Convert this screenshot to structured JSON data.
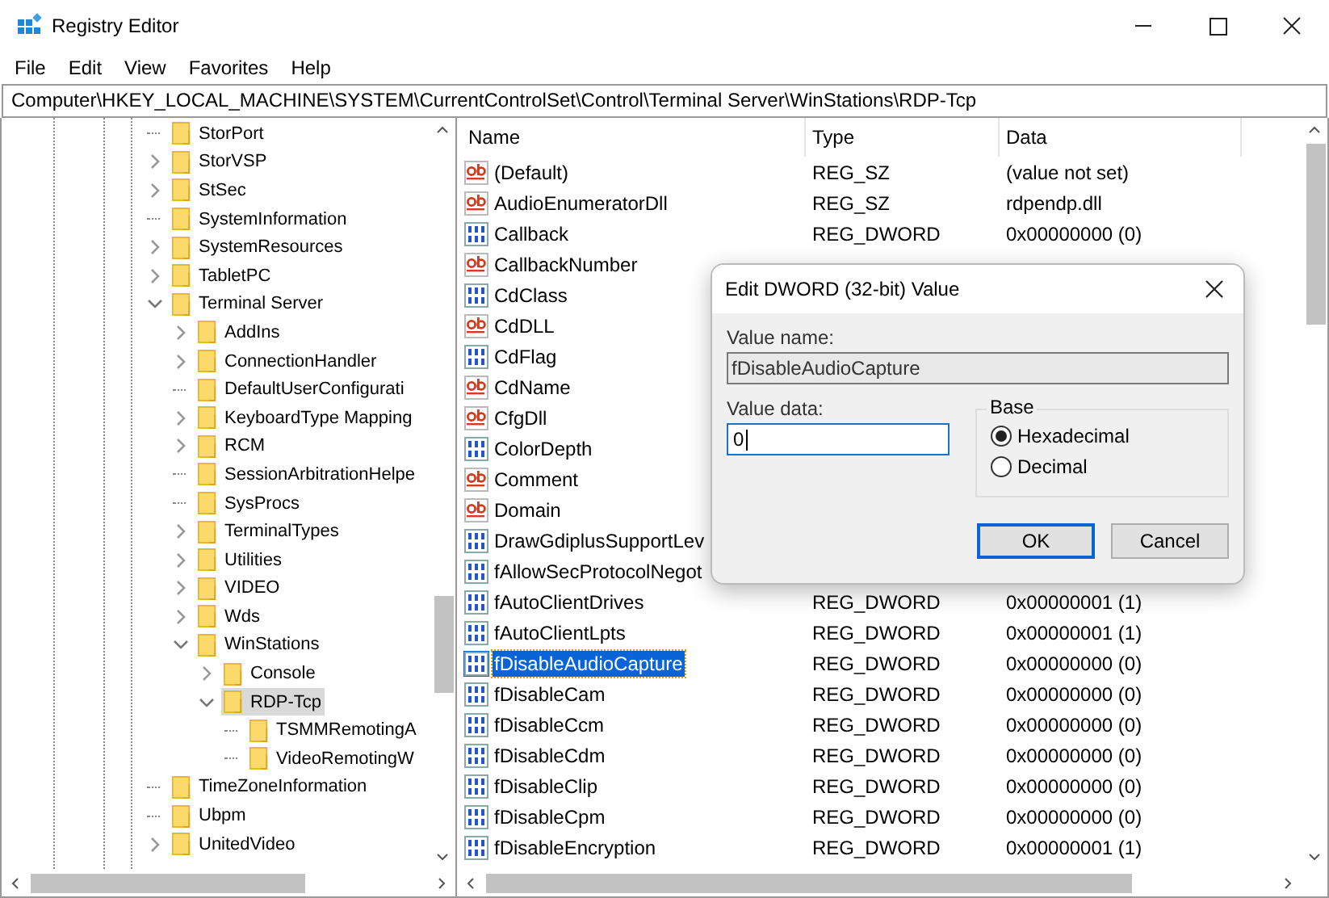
{
  "window": {
    "title": "Registry Editor"
  },
  "menu": [
    "File",
    "Edit",
    "View",
    "Favorites",
    "Help"
  ],
  "address": "Computer\\HKEY_LOCAL_MACHINE\\SYSTEM\\CurrentControlSet\\Control\\Terminal Server\\WinStations\\RDP-Tcp",
  "tree": [
    {
      "kind": "leaf",
      "label": "StorPort",
      "selected": false
    },
    {
      "kind": "branch",
      "label": "StorVSP",
      "expanded": false,
      "selected": false
    },
    {
      "kind": "branch",
      "label": "StSec",
      "expanded": false,
      "selected": false
    },
    {
      "kind": "leaf",
      "label": "SystemInformation",
      "selected": false
    },
    {
      "kind": "branch",
      "label": "SystemResources",
      "expanded": false,
      "selected": false
    },
    {
      "kind": "branch",
      "label": "TabletPC",
      "expanded": false,
      "selected": false
    },
    {
      "kind": "branch",
      "label": "Terminal Server",
      "expanded": true,
      "selected": false,
      "children": [
        {
          "kind": "branch",
          "label": "AddIns",
          "expanded": false,
          "selected": false
        },
        {
          "kind": "branch",
          "label": "ConnectionHandler",
          "expanded": false,
          "selected": false
        },
        {
          "kind": "leaf",
          "label": "DefaultUserConfigurati",
          "selected": false
        },
        {
          "kind": "branch",
          "label": "KeyboardType Mapping",
          "expanded": false,
          "selected": false
        },
        {
          "kind": "branch",
          "label": "RCM",
          "expanded": false,
          "selected": false
        },
        {
          "kind": "leaf",
          "label": "SessionArbitrationHelpe",
          "selected": false
        },
        {
          "kind": "leaf",
          "label": "SysProcs",
          "selected": false
        },
        {
          "kind": "branch",
          "label": "TerminalTypes",
          "expanded": false,
          "selected": false
        },
        {
          "kind": "branch",
          "label": "Utilities",
          "expanded": false,
          "selected": false
        },
        {
          "kind": "branch",
          "label": "VIDEO",
          "expanded": false,
          "selected": false
        },
        {
          "kind": "branch",
          "label": "Wds",
          "expanded": false,
          "selected": false
        },
        {
          "kind": "branch",
          "label": "WinStations",
          "expanded": true,
          "selected": false,
          "children": [
            {
              "kind": "branch",
              "label": "Console",
              "expanded": false,
              "selected": false
            },
            {
              "kind": "branch",
              "label": "RDP-Tcp",
              "expanded": true,
              "selected": true,
              "children": [
                {
                  "kind": "leaf",
                  "label": "TSMMRemotingA",
                  "selected": false
                },
                {
                  "kind": "leaf",
                  "label": "VideoRemotingW",
                  "selected": false
                }
              ]
            }
          ]
        }
      ]
    },
    {
      "kind": "leaf",
      "label": "TimeZoneInformation",
      "selected": false
    },
    {
      "kind": "leaf",
      "label": "Ubpm",
      "selected": false
    },
    {
      "kind": "branch",
      "label": "UnitedVideo",
      "expanded": false,
      "selected": false
    }
  ],
  "columns": [
    "Name",
    "Type",
    "Data"
  ],
  "rows": [
    {
      "kind": "sz",
      "name": "(Default)",
      "type": "REG_SZ",
      "data": "(value not set)",
      "selected": false
    },
    {
      "kind": "sz",
      "name": "AudioEnumeratorDll",
      "type": "REG_SZ",
      "data": "rdpendp.dll",
      "selected": false
    },
    {
      "kind": "dword",
      "name": "Callback",
      "type": "REG_DWORD",
      "data": "0x00000000 (0)",
      "selected": false
    },
    {
      "kind": "sz",
      "name": "CallbackNumber",
      "selected": false
    },
    {
      "kind": "dword",
      "name": "CdClass",
      "selected": false
    },
    {
      "kind": "sz",
      "name": "CdDLL",
      "selected": false
    },
    {
      "kind": "dword",
      "name": "CdFlag",
      "selected": false
    },
    {
      "kind": "sz",
      "name": "CdName",
      "selected": false
    },
    {
      "kind": "sz",
      "name": "CfgDll",
      "selected": false
    },
    {
      "kind": "dword",
      "name": "ColorDepth",
      "selected": false
    },
    {
      "kind": "sz",
      "name": "Comment",
      "selected": false
    },
    {
      "kind": "sz",
      "name": "Domain",
      "selected": false
    },
    {
      "kind": "dword",
      "name": "DrawGdiplusSupportLev",
      "selected": false
    },
    {
      "kind": "dword",
      "name": "fAllowSecProtocolNegot",
      "selected": false
    },
    {
      "kind": "dword",
      "name": "fAutoClientDrives",
      "type": "REG_DWORD",
      "data": "0x00000001 (1)",
      "selected": false
    },
    {
      "kind": "dword",
      "name": "fAutoClientLpts",
      "type": "REG_DWORD",
      "data": "0x00000001 (1)",
      "selected": false
    },
    {
      "kind": "dword",
      "name": "fDisableAudioCapture",
      "type": "REG_DWORD",
      "data": "0x00000000 (0)",
      "selected": true
    },
    {
      "kind": "dword",
      "name": "fDisableCam",
      "type": "REG_DWORD",
      "data": "0x00000000 (0)",
      "selected": false
    },
    {
      "kind": "dword",
      "name": "fDisableCcm",
      "type": "REG_DWORD",
      "data": "0x00000000 (0)",
      "selected": false
    },
    {
      "kind": "dword",
      "name": "fDisableCdm",
      "type": "REG_DWORD",
      "data": "0x00000000 (0)",
      "selected": false
    },
    {
      "kind": "dword",
      "name": "fDisableClip",
      "type": "REG_DWORD",
      "data": "0x00000000 (0)",
      "selected": false
    },
    {
      "kind": "dword",
      "name": "fDisableCpm",
      "type": "REG_DWORD",
      "data": "0x00000000 (0)",
      "selected": false
    },
    {
      "kind": "dword",
      "name": "fDisableEncryption",
      "type": "REG_DWORD",
      "data": "0x00000001 (1)",
      "selected": false
    }
  ],
  "dialog": {
    "title": "Edit DWORD (32-bit) Value",
    "name_label": "Value name:",
    "name_value": "fDisableAudioCapture",
    "data_label": "Value data:",
    "data_value": "0",
    "base_label": "Base",
    "bases": [
      {
        "label": "Hexadecimal",
        "selected": true
      },
      {
        "label": "Decimal",
        "selected": false
      }
    ],
    "buttons": [
      {
        "label": "OK",
        "default": true
      },
      {
        "label": "Cancel",
        "default": false
      }
    ]
  }
}
